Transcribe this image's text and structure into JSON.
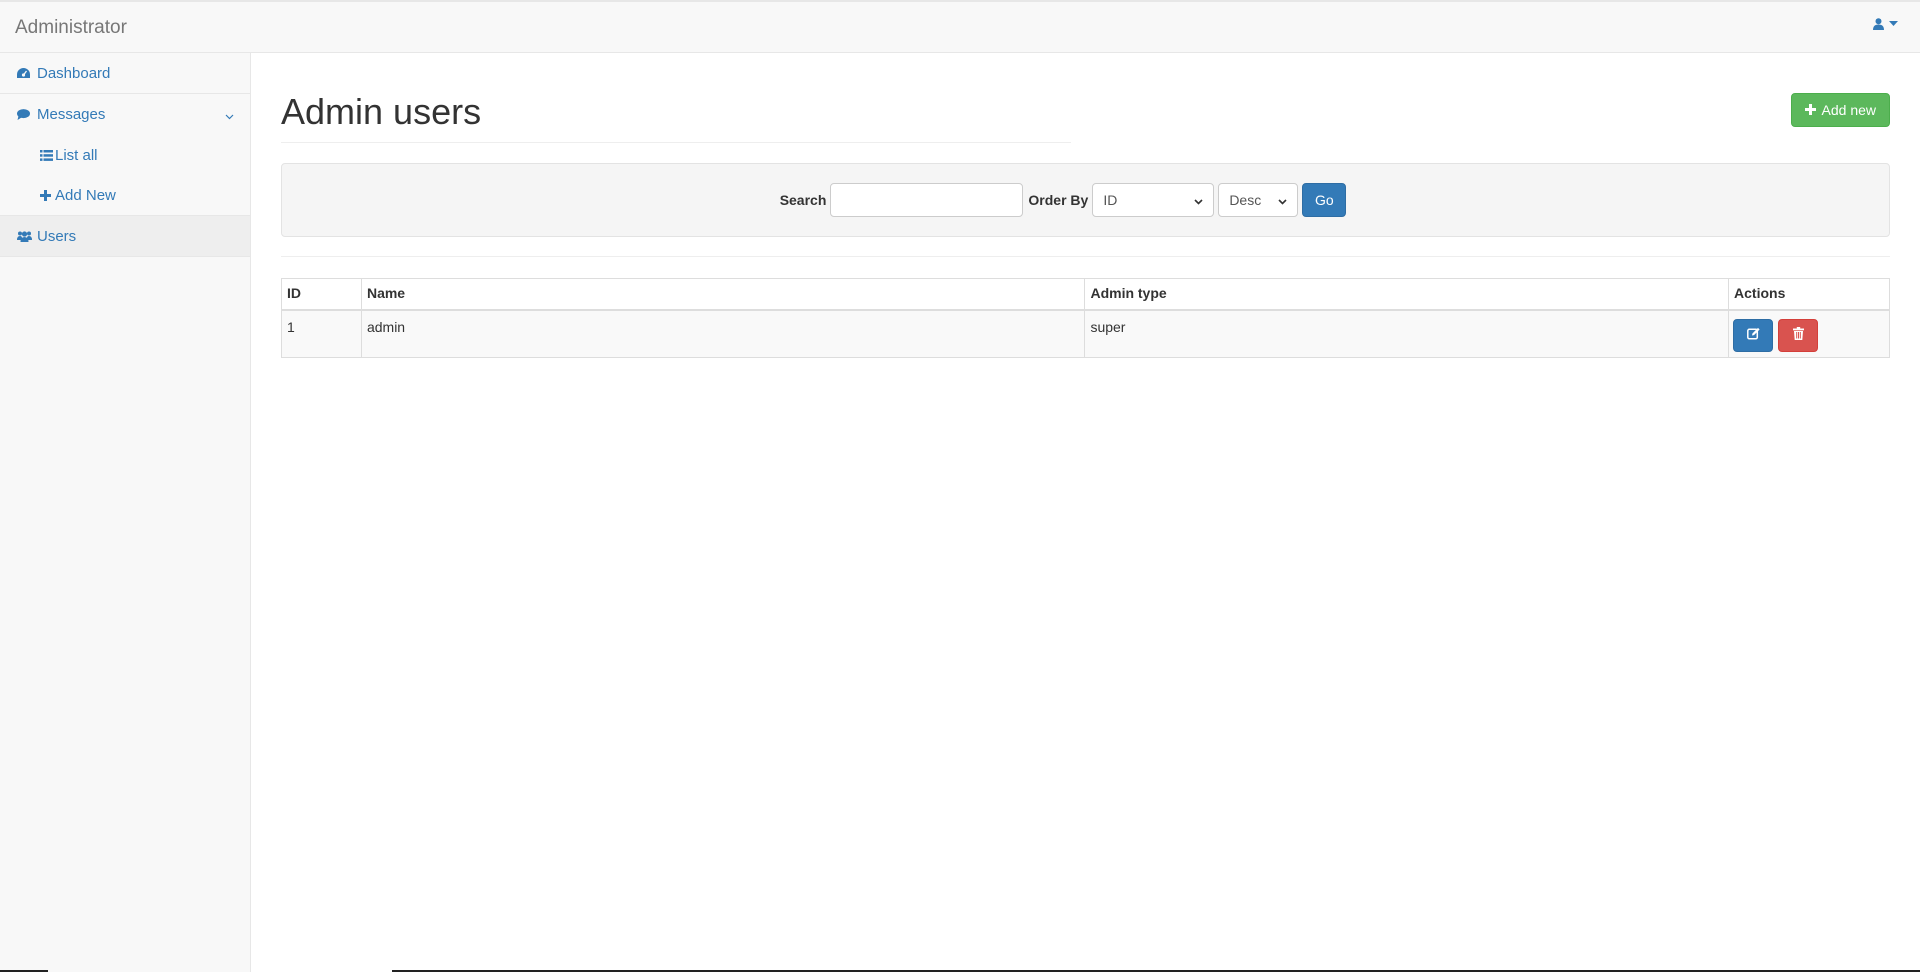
{
  "app": {
    "brand": "Administrator"
  },
  "header": {
    "user_icon": "user-icon",
    "caret_icon": "caret-down-icon"
  },
  "sidebar": {
    "items": [
      {
        "label": "Dashboard",
        "icon": "dashboard-icon"
      },
      {
        "label": "Messages",
        "icon": "comment-icon",
        "expanded": true,
        "children": [
          {
            "label": "List all",
            "icon": "list-icon"
          },
          {
            "label": "Add New",
            "icon": "plus-icon"
          }
        ]
      },
      {
        "label": "Users",
        "icon": "users-icon",
        "active": true
      }
    ]
  },
  "main": {
    "title": "Admin users",
    "add_button": "Add new",
    "filter": {
      "search_label": "Search",
      "search_value": "",
      "order_label": "Order By",
      "order_value": "ID",
      "direction_value": "Desc",
      "go_label": "Go"
    },
    "table": {
      "columns": [
        "ID",
        "Name",
        "Admin type",
        "Actions"
      ],
      "rows": [
        {
          "id": "1",
          "name": "admin",
          "admin_type": "super"
        }
      ]
    }
  },
  "colors": {
    "link": "#337ab7",
    "success": "#5cb85c",
    "primary": "#337ab7",
    "danger": "#d9534f"
  }
}
